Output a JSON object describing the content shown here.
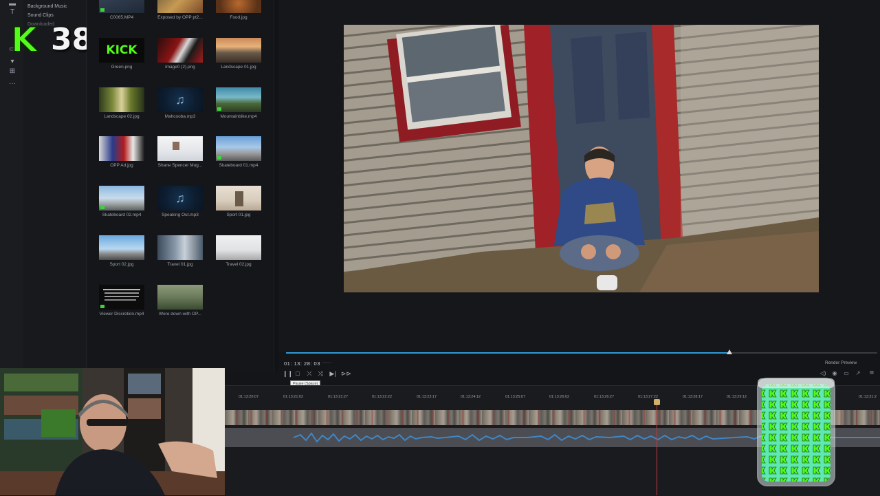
{
  "counter": {
    "logo_letter": "K",
    "value": "38"
  },
  "categories": [
    "Background Music",
    "Sound Clips",
    "Downloaded"
  ],
  "media": [
    {
      "label": "C0065.MP4",
      "kind": "video"
    },
    {
      "label": "Exposed by OPP pt2...",
      "kind": "image"
    },
    {
      "label": "Food.jpg",
      "kind": "image"
    },
    {
      "label": "Green.png",
      "kind": "kick"
    },
    {
      "label": "image0 (2).png",
      "kind": "image"
    },
    {
      "label": "Landscape 01.jpg",
      "kind": "image"
    },
    {
      "label": "Landscape 02.jpg",
      "kind": "image"
    },
    {
      "label": "Mahcooba.mp3",
      "kind": "music"
    },
    {
      "label": "Mountainbike.mp4",
      "kind": "video"
    },
    {
      "label": "OPP Ad.jpg",
      "kind": "image"
    },
    {
      "label": "Shane Spencer Mug...",
      "kind": "image"
    },
    {
      "label": "Skateboard 01.mp4",
      "kind": "video"
    },
    {
      "label": "Skateboard 02.mp4",
      "kind": "video"
    },
    {
      "label": "Speaking Out.mp3",
      "kind": "music"
    },
    {
      "label": "Sport 01.jpg",
      "kind": "image"
    },
    {
      "label": "Sport 02.jpg",
      "kind": "image"
    },
    {
      "label": "Travel 01.jpg",
      "kind": "image"
    },
    {
      "label": "Travel 02.jpg",
      "kind": "image"
    },
    {
      "label": "Viewer Discretion.mp4",
      "kind": "video"
    },
    {
      "label": "Were down with OP...",
      "kind": "image"
    }
  ],
  "kick_logo_text": "KICK",
  "player": {
    "timecode": "01: 13: 28: 03",
    "tooltip": "Pause (Space)",
    "render_preview": "Render Preview",
    "progress": 0.75
  },
  "timeline": {
    "ruler": [
      "01:13:20:07",
      "01:13:21:02",
      "01:13:21:27",
      "01:13:22:22",
      "01:13:23:17",
      "01:13:24:12",
      "01:13:25:07",
      "01:13:26:02",
      "01:13:26:27",
      "01:13:27:22",
      "01:13:28:17",
      "01:13:29:12",
      "01:13:31:2"
    ]
  },
  "icons": {
    "tools": [
      "text-tool-icon",
      "crop-icon",
      "layers-icon",
      "effects-icon",
      "more-icon"
    ],
    "transport": [
      "pause-icon",
      "stop-icon",
      "prev-frame-icon",
      "next-frame-icon",
      "mark-icon",
      "fast-forward-icon"
    ],
    "preview_controls": [
      "volume-icon",
      "snapshot-icon",
      "display-icon",
      "external-view-icon",
      "aspect-icon"
    ]
  },
  "colors": {
    "accent": "#2e9bd6",
    "kick_green": "#53fc18",
    "playhead": "#c23a3a"
  }
}
